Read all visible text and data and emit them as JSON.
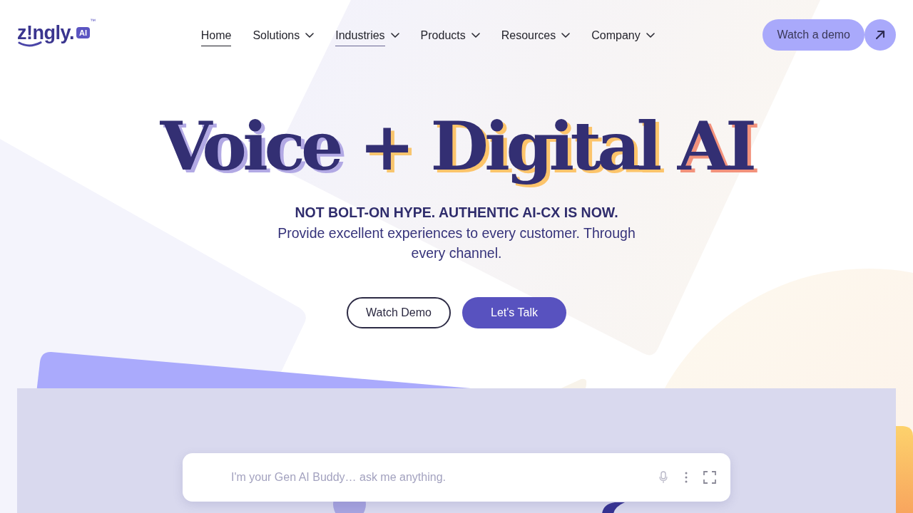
{
  "header": {
    "logo": {
      "wordmark": "z!ngly.",
      "badge": "AI",
      "trademark": "™"
    },
    "nav": [
      {
        "label": "Home",
        "selected": true,
        "hovered": false,
        "has_menu": false
      },
      {
        "label": "Solutions",
        "selected": false,
        "hovered": false,
        "has_menu": true
      },
      {
        "label": "Industries",
        "selected": false,
        "hovered": true,
        "has_menu": true
      },
      {
        "label": "Products",
        "selected": false,
        "hovered": false,
        "has_menu": true
      },
      {
        "label": "Resources",
        "selected": false,
        "hovered": false,
        "has_menu": true
      },
      {
        "label": "Company",
        "selected": false,
        "hovered": false,
        "has_menu": true
      }
    ],
    "cta": {
      "label": "Watch a demo"
    }
  },
  "hero": {
    "title": "Voice + Digital AI",
    "tagline": "NOT BOLT-ON HYPE. AUTHENTIC AI-CX IS NOW.",
    "description": "Provide excellent experiences to every customer. Through every channel.",
    "buttons": [
      {
        "label": "Watch Demo",
        "kind": "outline"
      },
      {
        "label": "Let's Talk",
        "kind": "filled"
      }
    ]
  },
  "chat": {
    "placeholder": "I'm your Gen AI Buddy… ask me anything."
  }
}
